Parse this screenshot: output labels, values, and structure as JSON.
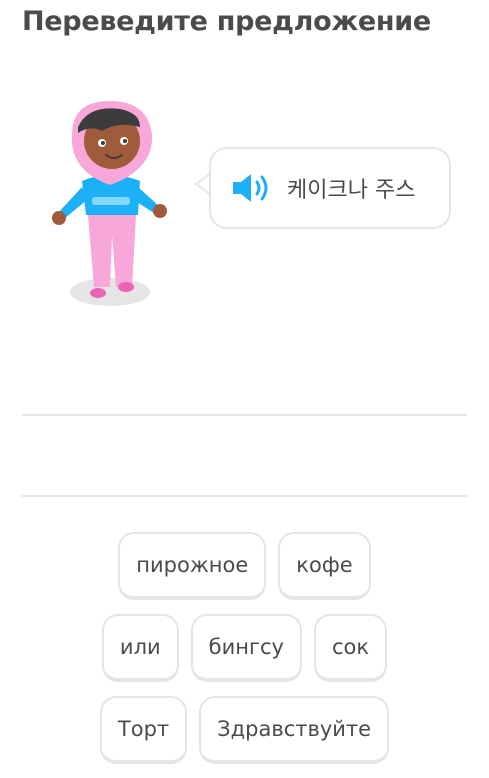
{
  "header": {
    "title": "Переведите предложение"
  },
  "prompt": {
    "audio_icon": "speaker-icon",
    "sentence": "케이크나 주스"
  },
  "word_bank": {
    "rows": [
      [
        "пирожное",
        "кофе"
      ],
      [
        "или",
        "бингсу",
        "сок"
      ],
      [
        "Торт",
        "Здравствуйте"
      ]
    ]
  },
  "colors": {
    "text": "#4b4b4b",
    "border": "#e5e5e5",
    "speaker": "#1cb0f6",
    "hijab": "#f7a8d8",
    "shirt": "#1cb0f6"
  }
}
